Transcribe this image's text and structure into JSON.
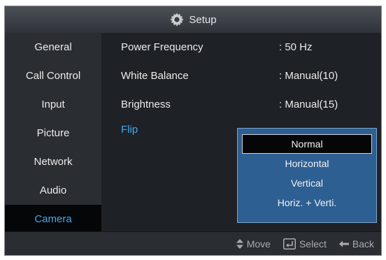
{
  "header": {
    "title": "Setup",
    "icon": "gear-icon"
  },
  "sidebar": {
    "items": [
      {
        "label": "General"
      },
      {
        "label": "Call Control"
      },
      {
        "label": "Input"
      },
      {
        "label": "Picture"
      },
      {
        "label": "Network"
      },
      {
        "label": "Audio"
      },
      {
        "label": "Camera"
      }
    ],
    "active": "Camera"
  },
  "settings": {
    "power_frequency": {
      "label": "Power Frequency",
      "value": ": 50 Hz"
    },
    "white_balance": {
      "label": "White Balance",
      "value": ": Manual(10)"
    },
    "brightness": {
      "label": "Brightness",
      "value": ": Manual(15)"
    },
    "flip": {
      "label": "Flip"
    }
  },
  "flip_dropdown": {
    "options": [
      "Normal",
      "Horizontal",
      "Vertical",
      "Horiz. + Verti."
    ],
    "selected": "Normal"
  },
  "footer": {
    "move": "Move",
    "select": "Select",
    "back": "Back"
  },
  "colors": {
    "accent": "#43a8ee",
    "dropdown_bg": "#2e5f93",
    "panel_bg": "#1e2126",
    "sidebar_bg": "#2a2d32"
  }
}
